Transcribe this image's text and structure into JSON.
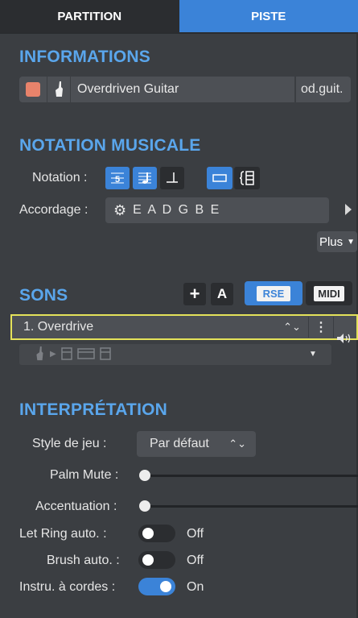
{
  "tabs": {
    "partition": "PARTITION",
    "piste": "PISTE"
  },
  "informations": {
    "title": "INFORMATIONS",
    "track_name": "Overdriven Guitar",
    "short_name": "od.guit.",
    "color": "#e8836b"
  },
  "notation": {
    "title": "NOTATION MUSICALE",
    "notation_label": "Notation :",
    "tuning_label": "Accordage :",
    "tuning_value": "E A D G B E",
    "plus_label": "Plus"
  },
  "sons": {
    "title": "SONS",
    "rse_label": "RSE",
    "midi_label": "MIDI",
    "add_symbol": "+",
    "auto_label": "A",
    "sound_name": "1. Overdrive"
  },
  "interpretation": {
    "title": "INTERPRÉTATION",
    "style_label": "Style de jeu :",
    "style_value": "Par défaut",
    "palm_mute_label": "Palm Mute :",
    "accent_label": "Accentuation :",
    "let_ring_label": "Let Ring auto. :",
    "let_ring_state": "Off",
    "brush_label": "Brush auto. :",
    "brush_state": "Off",
    "strings_label": "Instru. à cordes :",
    "strings_state": "On"
  },
  "colors": {
    "accent": "#3b83d8",
    "section": "#5aa6ec",
    "highlight": "#e4e25a"
  }
}
